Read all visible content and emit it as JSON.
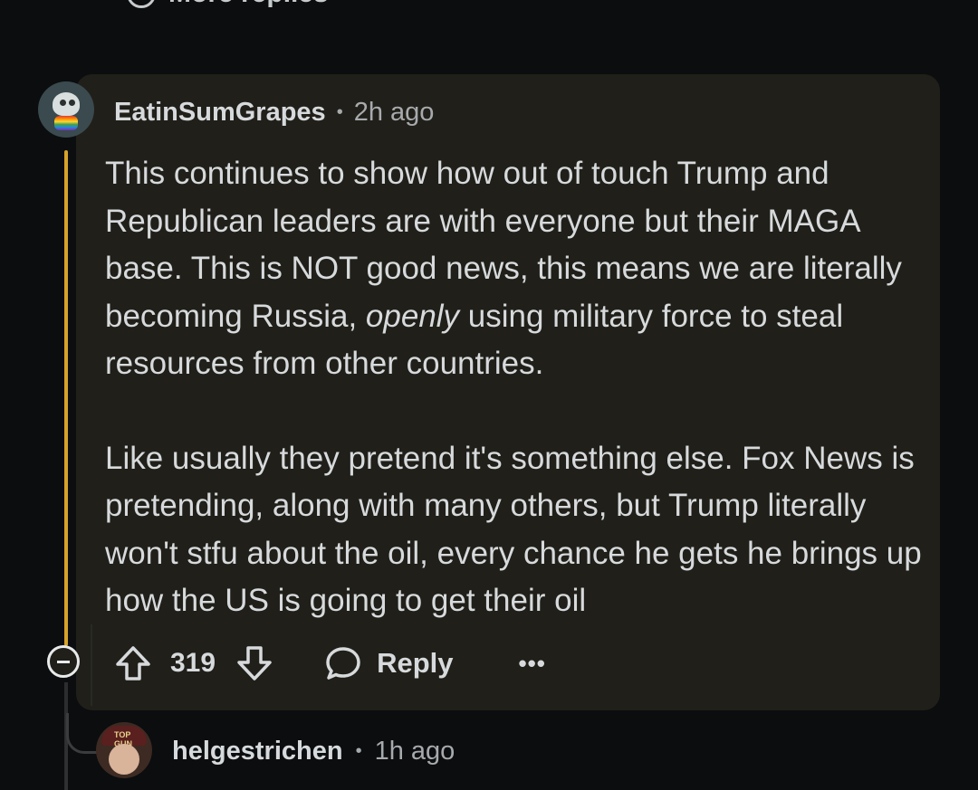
{
  "thread": {
    "more_replies_label": "More replies"
  },
  "comment": {
    "username": "EatinSumGrapes",
    "separator": "•",
    "time": "2h ago",
    "paragraph1_part1": "This continues to show how out of touch Trump and Republican leaders are with everyone but their MAGA base. This is NOT good news, this means we are literally becoming Russia, ",
    "paragraph1_emphasis": "openly",
    "paragraph1_part2": " using military force to steal resources from other countries.",
    "paragraph2": "Like usually they pretend it's something else. Fox News is pretending, along with many others, but Trump literally won't stfu about the oil, every chance he gets he brings up how the US is going to get their oil",
    "votes": "319",
    "reply_label": "Reply",
    "more_label": "•••"
  },
  "child_comment": {
    "username": "helgestrichen",
    "separator": "•",
    "time": "1h ago",
    "avatar_cap_text": "TOP GUN"
  },
  "colors": {
    "background": "#0b0d0f",
    "card": "#201f19",
    "thread_accent": "#d8a32a",
    "text": "#d7dadc",
    "muted": "#a7aaad"
  },
  "icons": {
    "collapse": "collapse-icon",
    "upvote": "upvote-arrow-icon",
    "downvote": "downvote-arrow-icon",
    "reply": "speech-bubble-icon",
    "more": "more-options-icon"
  }
}
